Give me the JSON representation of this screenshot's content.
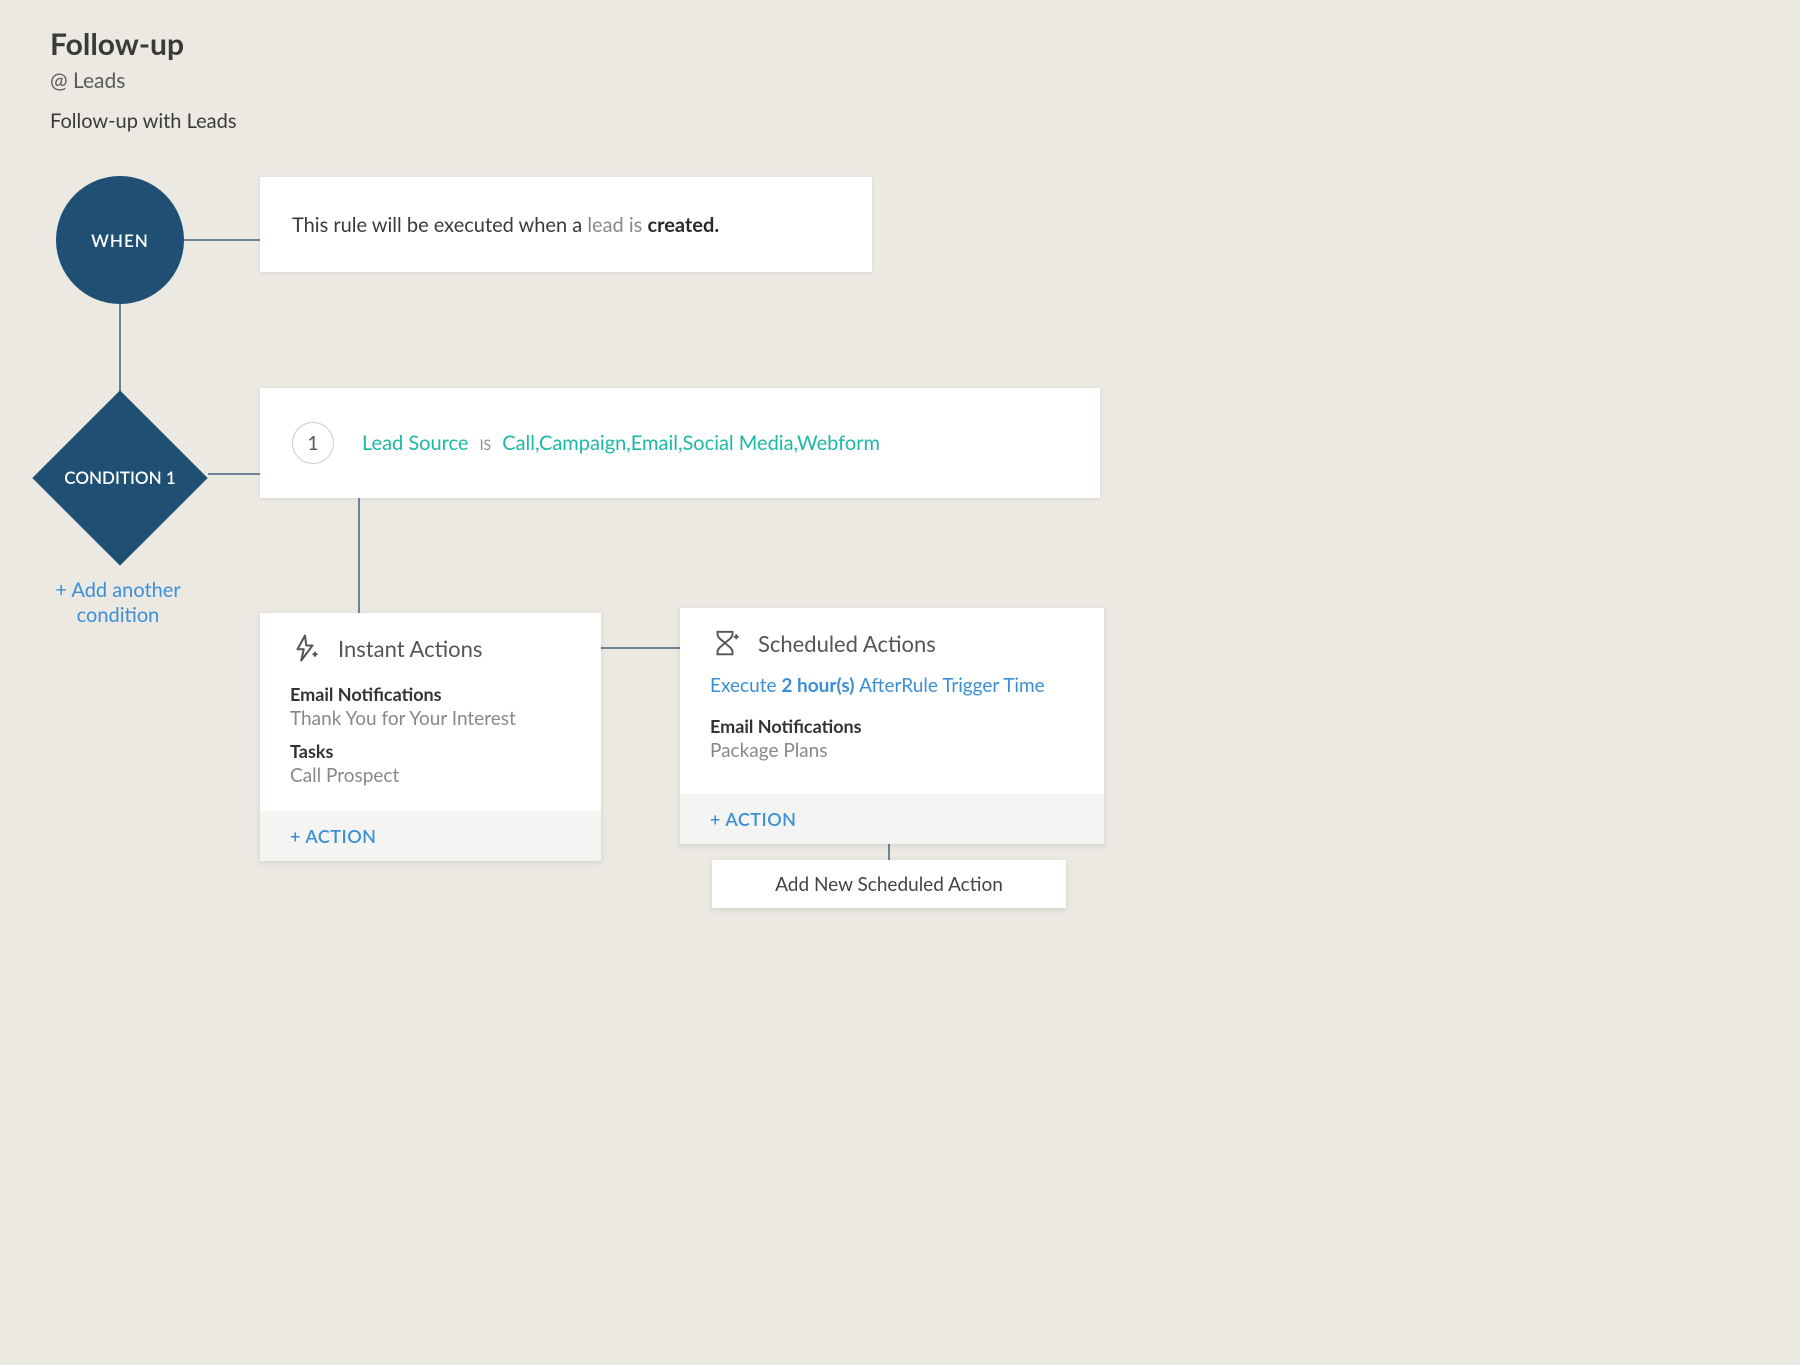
{
  "header": {
    "title": "Follow-up",
    "scope": "@  Leads",
    "description": "Follow-up with Leads"
  },
  "when": {
    "node_label": "WHEN",
    "panel_prefix": "This rule will be executed when a ",
    "panel_subject": "lead is ",
    "panel_state": "created."
  },
  "condition": {
    "node_label": "CONDITION 1",
    "number": "1",
    "field": "Lead Source",
    "operator": "IS",
    "value": "Call,Campaign,Email,Social Media,Webform",
    "add_link": "+ Add another condition"
  },
  "instant": {
    "title": "Instant Actions",
    "sections": [
      {
        "heading": "Email Notifications",
        "item": "Thank You for Your Interest"
      },
      {
        "heading": "Tasks",
        "item": "Call Prospect"
      }
    ],
    "add_action": "+ ACTION"
  },
  "scheduled": {
    "title": "Scheduled Actions",
    "execute_prefix": "Execute ",
    "execute_bold": "2 hour(s) ",
    "execute_suffix": "After",
    "execute_trail": "Rule Trigger Time",
    "section_heading": "Email Notifications",
    "section_item": "Package Plans",
    "add_action": "+ ACTION",
    "add_new_btn": "Add New Scheduled Action"
  }
}
